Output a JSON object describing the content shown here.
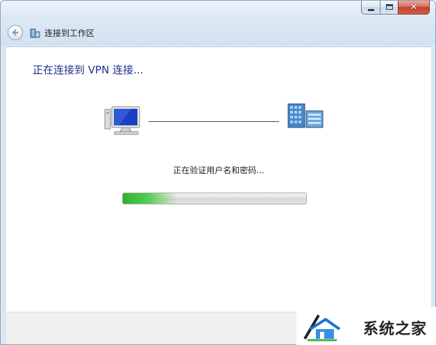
{
  "window": {
    "title": "连接到工作区",
    "close_glyph": "✕"
  },
  "main": {
    "heading": "正在连接到 VPN 连接...",
    "status": "正在验证用户名和密码...",
    "progress_fraction": 0.3
  },
  "icons": {
    "back": "back-arrow-icon",
    "wizard": "workplace-building-icon",
    "client": "computer-icon",
    "server": "server-icon"
  },
  "watermark": {
    "text": "系统之家"
  }
}
